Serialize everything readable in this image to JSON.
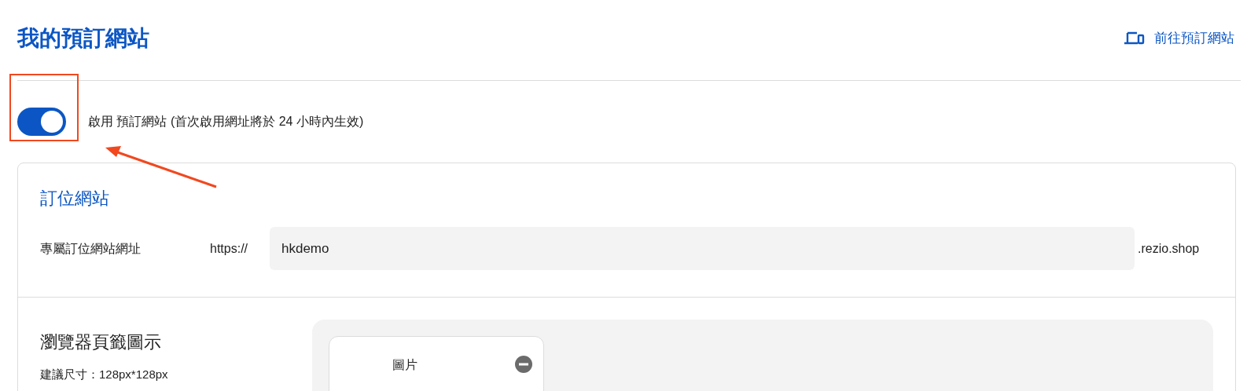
{
  "header": {
    "title": "我的預訂網站",
    "link": "前往預訂網站"
  },
  "enable_toggle": {
    "on": true,
    "label": "啟用 預訂網站 (首次啟用網址將於 24 小時內生效)",
    "highlighted": true
  },
  "site_section": {
    "title": "訂位網站",
    "url_label": "專屬訂位網站網址",
    "prefix": "https://",
    "value": "hkdemo",
    "suffix": ".rezio.shop"
  },
  "favicon_section": {
    "title": "瀏覽器頁籤圖示",
    "hint": "建議尺寸：128px*128px",
    "image_label": "圖片"
  }
}
